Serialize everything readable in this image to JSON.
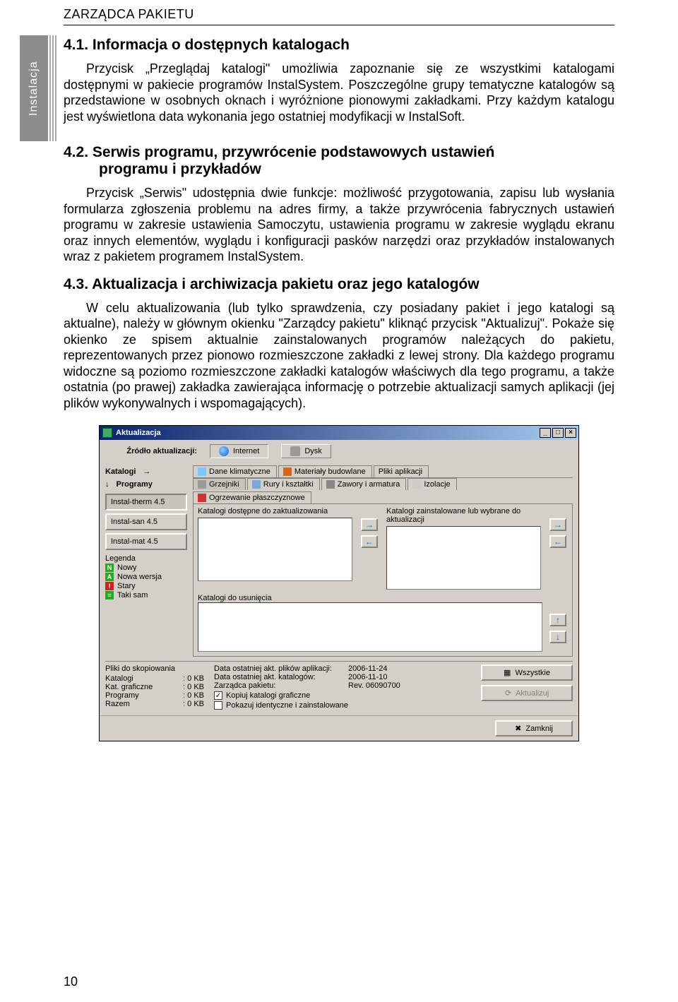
{
  "header": "ZARZĄDCA PAKIETU",
  "sidebar_tab": "Instalacja",
  "page_number": "10",
  "s41": {
    "title": "4.1.  Informacja o dostępnych katalogach",
    "p1": "Przycisk „Przeglądaj katalogi\" umożliwia zapoznanie się ze wszystkimi katalogami dostępnymi w pakiecie programów InstalSystem. Poszczególne grupy tematyczne katalogów są przedstawione w osobnych oknach i wyróżnione pionowymi zakładkami. Przy każdym katalogu jest wyświetlona data wykonania jego ostatniej modyfikacji w InstalSoft."
  },
  "s42": {
    "title_l1": "4.2.  Serwis  programu,  przywrócenie  podstawowych  ustawień",
    "title_l2": "programu i przykładów",
    "p1": "Przycisk „Serwis\" udostępnia dwie funkcje: możliwość przygotowania, zapisu lub wysłania formularza zgłoszenia problemu na adres firmy, a także przywrócenia fabrycznych ustawień programu w zakresie ustawienia Samoczytu, ustawienia programu w zakresie wyglądu ekranu oraz innych elementów, wyglądu i konfiguracji pasków narzędzi oraz przykładów instalowanych wraz z pakietem programem InstalSystem."
  },
  "s43": {
    "title": "4.3.  Aktualizacja i archiwizacja pakietu oraz jego katalogów",
    "p1": "W celu aktualizowania (lub tylko sprawdzenia, czy posiadany pakiet i jego katalogi są aktualne), należy w głównym okienku \"Zarządcy pakietu\" kliknąć przycisk \"Aktualizuj\". Pokaże się okienko ze spisem aktualnie zainstalowanych programów należących do pakietu, reprezentowanych przez pionowo rozmieszczone zakładki z lewej strony. Dla każdego programu widoczne są  poziomo rozmieszczone zakładki katalogów właściwych dla tego programu, a także ostatnia (po prawej) zakładka zawierająca informację o potrzebie aktualizacji samych aplikacji (jej plików wykonywalnych i wspomagających)."
  },
  "dlg": {
    "title": "Aktualizacja",
    "source_label": "Źródło aktualizacji:",
    "src_internet": "Internet",
    "src_disk": "Dysk",
    "catalogs_label": "Katalogi",
    "programs_label": "Programy",
    "programs": [
      "Instal-therm 4.5",
      "Instal-san 4.5",
      "Instal-mat 4.5"
    ],
    "tabs_row1": [
      "Dane klimatyczne",
      "Materiały budowlane",
      "Pliki aplikacji"
    ],
    "tabs_row2": [
      "Grzejniki",
      "Rury i kształtki",
      "Zawory i armatura",
      "Izolacje",
      "Ogrzewanie płaszczyznowe"
    ],
    "avail_hdr": "Katalogi dostępne do zaktualizowania",
    "inst_hdr": "Katalogi zainstalowane lub wybrane do aktualizacji",
    "remove_hdr": "Katalogi do usunięcia",
    "legend_title": "Legenda",
    "legend": [
      {
        "code": "N",
        "label": "Nowy",
        "cls": "g"
      },
      {
        "code": "A",
        "label": "Nowa wersja",
        "cls": "g"
      },
      {
        "code": "!",
        "label": "Stary",
        "cls": "r"
      },
      {
        "code": "=",
        "label": "Taki sam",
        "cls": "dg"
      }
    ],
    "files_hdr": "Pliki do skopiowania",
    "files": [
      {
        "k": "Katalogi",
        "v": ": 0 KB"
      },
      {
        "k": "Kat. graficzne",
        "v": ": 0 KB"
      },
      {
        "k": "Programy",
        "v": ": 0 KB"
      },
      {
        "k": "Razem",
        "v": ": 0 KB"
      }
    ],
    "info": [
      {
        "k": "Data ostatniej akt. plików aplikacji:",
        "v": "2006-11-24"
      },
      {
        "k": "Data ostatniej akt. katalogów:",
        "v": "2006-11-10"
      },
      {
        "k": "Zarządca pakietu:",
        "v": "Rev. 06090700"
      }
    ],
    "chk1": "Kopiuj katalogi graficzne",
    "chk2": "Pokazuj identyczne i zainstalowane",
    "btn_all": "Wszystkie",
    "btn_update": "Aktualizuj",
    "btn_close": "Zamknij"
  }
}
